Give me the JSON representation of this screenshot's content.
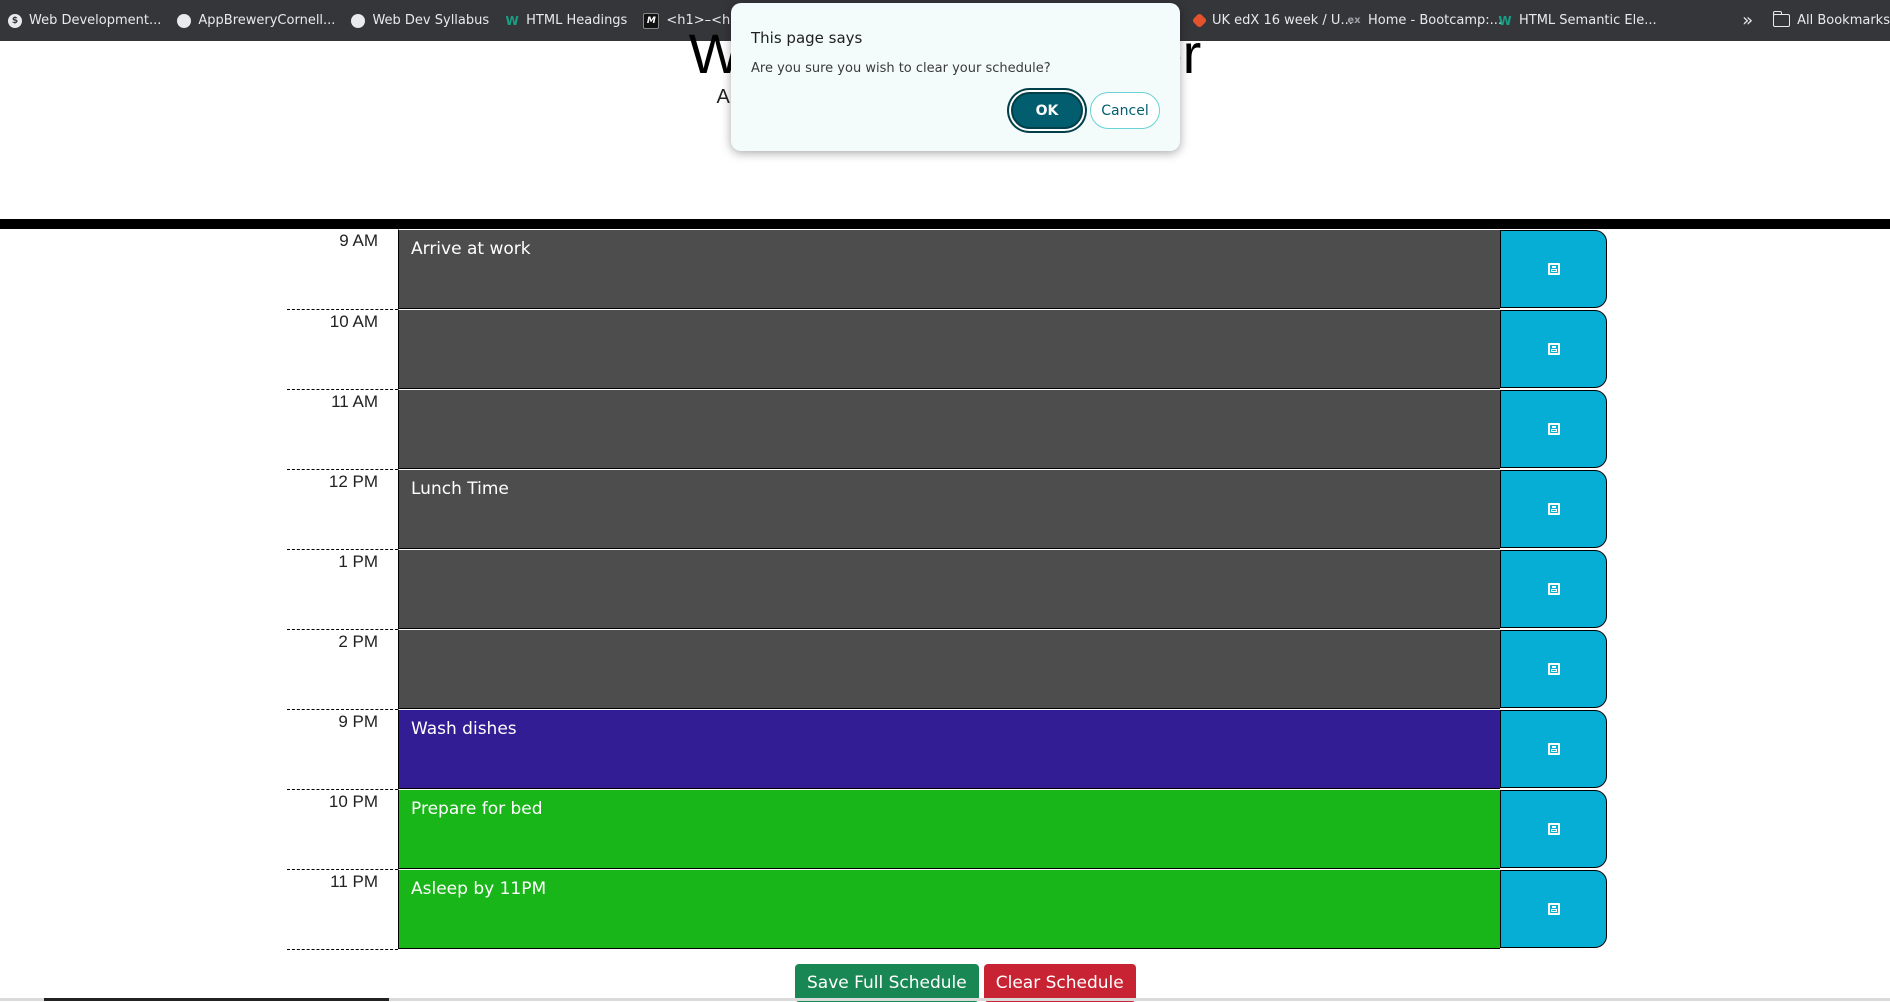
{
  "bookmarks": {
    "items": [
      {
        "label": "Web Development...",
        "icon": "wallet-icon"
      },
      {
        "label": "AppBreweryCornell...",
        "icon": "globe-icon"
      },
      {
        "label": "Web Dev Syllabus",
        "icon": "globe-icon"
      },
      {
        "label": "HTML Headings",
        "icon": "w3schools-icon"
      },
      {
        "label": "<h1>–<h6>: The H...",
        "icon": "mdn-icon"
      },
      {
        "label": "UK edX 16 week / U...",
        "icon": "gitlab-icon"
      },
      {
        "label": "Home - Bootcamp:...",
        "icon": "edx-icon"
      },
      {
        "label": "HTML Semantic Ele...",
        "icon": "w3schools-icon"
      }
    ],
    "more_label": "»",
    "all_bookmarks_label": "All Bookmarks"
  },
  "header": {
    "title": "Work Day Scheduler",
    "subtitle": "A simple calendar app for scheduling your work day"
  },
  "dialog": {
    "title": "This page says",
    "message": "Are you sure you wish to clear your schedule?",
    "ok_label": "OK",
    "cancel_label": "Cancel"
  },
  "schedule": {
    "rows": [
      {
        "hour": "9 AM",
        "task": "Arrive at work",
        "state": "past"
      },
      {
        "hour": "10 AM",
        "task": "",
        "state": "past"
      },
      {
        "hour": "11 AM",
        "task": "",
        "state": "past"
      },
      {
        "hour": "12 PM",
        "task": "Lunch Time",
        "state": "past"
      },
      {
        "hour": "1 PM",
        "task": "",
        "state": "past"
      },
      {
        "hour": "2 PM",
        "task": "",
        "state": "past"
      },
      {
        "hour": "9 PM",
        "task": "Wash dishes",
        "state": "present"
      },
      {
        "hour": "10 PM",
        "task": "Prepare for bed",
        "state": "future"
      },
      {
        "hour": "11 PM",
        "task": "Asleep by 11PM",
        "state": "future"
      }
    ],
    "save_icon": "floppy-disk-icon"
  },
  "actions": {
    "save_all_label": "Save Full Schedule",
    "clear_label": "Clear Schedule"
  },
  "colors": {
    "past": "#4d4d4d",
    "present": "#321d94",
    "future": "#19b619",
    "save_button": "#06aed5",
    "dialog_ok": "#025e6e",
    "success": "#198754",
    "danger": "#c82333"
  }
}
